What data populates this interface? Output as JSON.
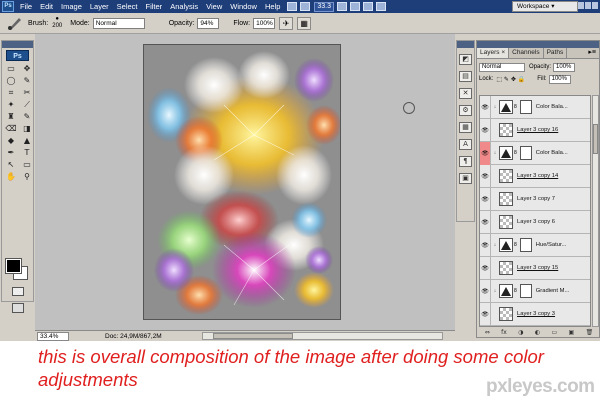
{
  "menu": {
    "logo": "Ps",
    "items": [
      "File",
      "Edit",
      "Image",
      "Layer",
      "Select",
      "Filter",
      "Analysis",
      "View",
      "Window",
      "Help"
    ],
    "zoom": "33.3",
    "workspace": "Workspace ▾"
  },
  "options": {
    "brush_label": "Brush:",
    "brush_size": "200",
    "mode_label": "Mode:",
    "mode_value": "Normal",
    "opacity_label": "Opacity:",
    "opacity_value": "94%",
    "flow_label": "Flow:",
    "flow_value": "100%"
  },
  "toolbox": {
    "logo": "Ps",
    "tools": [
      "▭",
      "✥",
      "◯",
      "✎",
      "⌗",
      "✂",
      "✦",
      "⟋",
      "♜",
      "✎",
      "⌫",
      "◨",
      "◆",
      "▲",
      "✒",
      "T",
      "↖",
      "▭",
      "✋",
      "⚲"
    ]
  },
  "status": {
    "zoom": "33.4%",
    "doc": "Doc: 24,9M/867,2M"
  },
  "dock_icons": [
    "◩",
    "▤",
    "✕",
    "⚙",
    "▦",
    "A",
    "¶",
    "▣"
  ],
  "layers_panel": {
    "tabs": [
      "Layers ×",
      "Channels",
      "Paths"
    ],
    "menu": "▸≡",
    "blend_mode": "Normal",
    "opacity_label": "Opacity:",
    "opacity_value": "100%",
    "lock_label": "Lock:",
    "lock_icons": "⬚ ✎ ✥ 🔒",
    "fill_label": "Fill:",
    "fill_value": "100%",
    "layers": [
      {
        "name": "Color Bala...",
        "type": "adj",
        "underline": false,
        "selected": false
      },
      {
        "name": "Layer 3 copy 16",
        "type": "pixel",
        "underline": true,
        "selected": false
      },
      {
        "name": "Color Bala...",
        "type": "adj",
        "underline": false,
        "selected": true
      },
      {
        "name": "Layer 3 copy 14",
        "type": "pixel",
        "underline": true,
        "selected": false
      },
      {
        "name": "Layer 3 copy 7",
        "type": "pixel",
        "underline": false,
        "selected": false
      },
      {
        "name": "Layer 3 copy 6",
        "type": "pixel",
        "underline": false,
        "selected": false
      },
      {
        "name": "Hue/Satur...",
        "type": "adj",
        "underline": false,
        "selected": false
      },
      {
        "name": "Layer 3 copy 15",
        "type": "pixel",
        "underline": true,
        "selected": false
      },
      {
        "name": "Gradient M...",
        "type": "adj",
        "underline": false,
        "selected": false
      },
      {
        "name": "Layer 3 copy 3",
        "type": "pixel",
        "underline": true,
        "selected": false
      }
    ],
    "footer_icons": [
      "⇔",
      "fx",
      "◑",
      "◐",
      "▭",
      "▣",
      "🗑"
    ]
  },
  "caption": "this is overall composition of the image after doing some color adjustments",
  "watermark": "pxleyes.com"
}
